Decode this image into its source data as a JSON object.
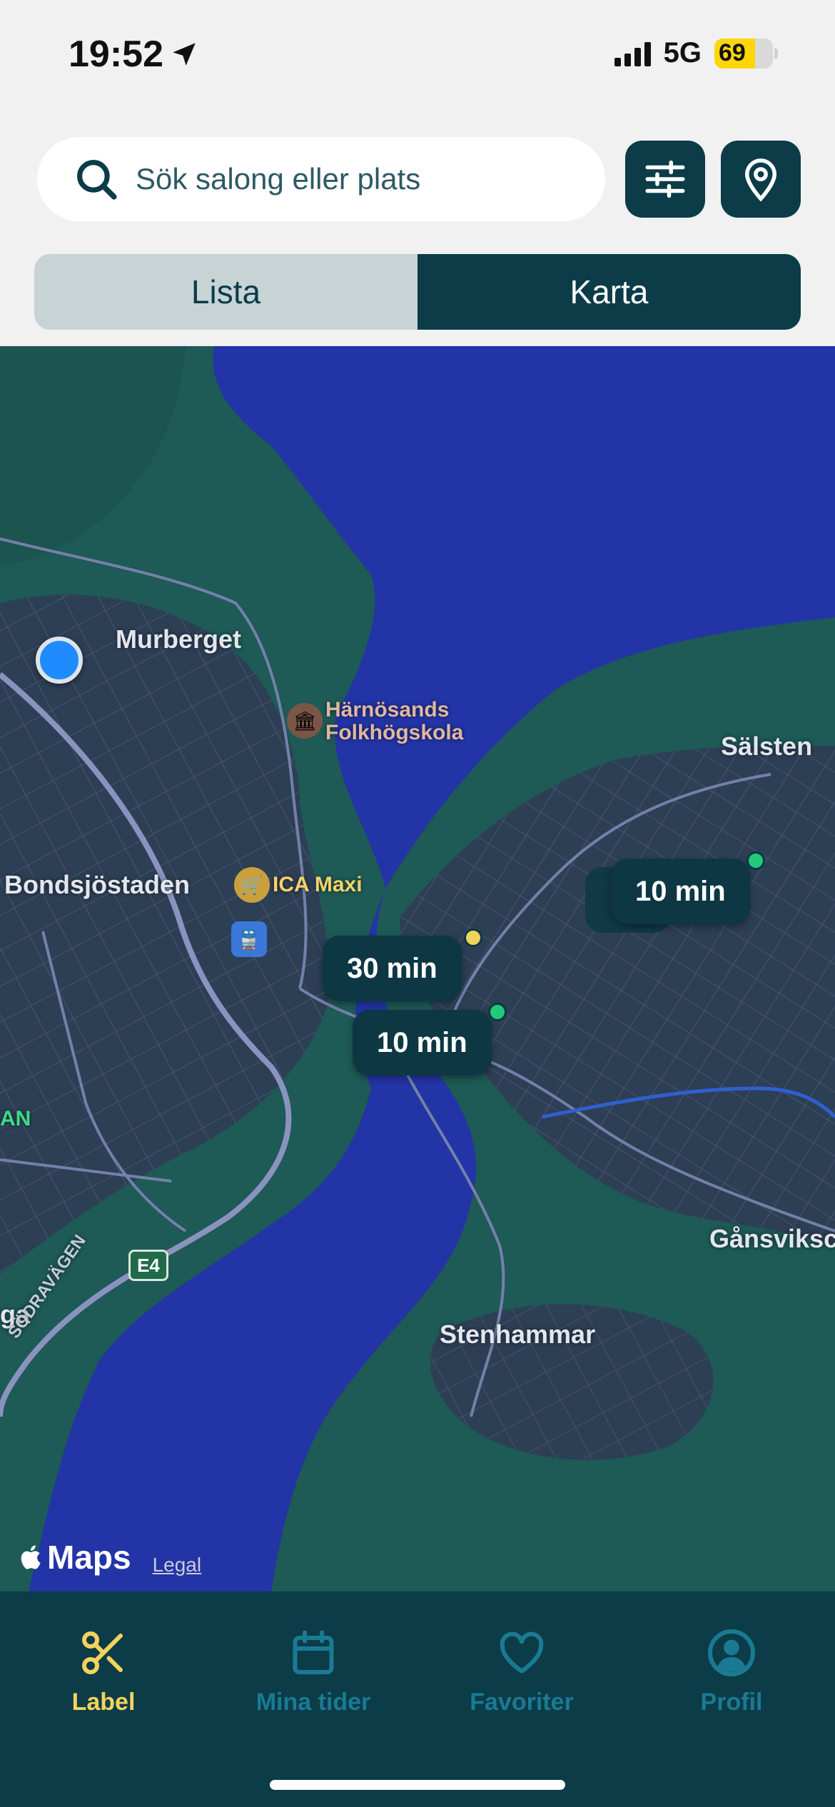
{
  "status_bar": {
    "time": "19:52",
    "network": "5G",
    "battery": "69",
    "battery_level": 0.69,
    "icons": [
      "location-arrow-icon",
      "signal-bars-icon",
      "battery-icon"
    ]
  },
  "search": {
    "placeholder": "Sök salong eller plats",
    "value": "",
    "icons": [
      "search-icon",
      "filter-sliders-icon",
      "location-pin-icon"
    ]
  },
  "view_toggle": {
    "list_label": "Lista",
    "map_label": "Karta",
    "selected": "Karta"
  },
  "map": {
    "places": {
      "murberget": "Murberget",
      "harnosands": "Härnösands",
      "folkhogskola": "Folkhögskola",
      "salsten": "Sälsten",
      "bondsjostaden": "Bondsjöstaden",
      "ica_maxi": "ICA Maxi",
      "gansvik": "Gånsviksc",
      "stenhammar": "Stenhammar",
      "sodravagen": "SÖDRAVÄGEN",
      "road_e4": "E4",
      "partial_an": "AN",
      "partial_ga": "ga"
    },
    "pins": [
      {
        "label": "10 min",
        "status_color": "#22c97a"
      },
      {
        "label": "30 min",
        "status_color": "#f2d35a"
      },
      {
        "label": "10 min",
        "status_color": "#22c97a"
      }
    ],
    "brand": "Maps",
    "legal": "Legal",
    "colors": {
      "water": "#2334a6",
      "land": "#1e5a56",
      "urban": "#2d3f55",
      "roads": "#8a93bf"
    }
  },
  "tabbar": {
    "tabs": [
      {
        "label": "Label",
        "icon": "scissors-icon",
        "active": true
      },
      {
        "label": "Mina tider",
        "icon": "calendar-icon",
        "active": false
      },
      {
        "label": "Favoriter",
        "icon": "heart-icon",
        "active": false
      },
      {
        "label": "Profil",
        "icon": "profile-icon",
        "active": false
      }
    ],
    "active_color": "#f6d35c",
    "inactive_color": "#1b7a93"
  }
}
